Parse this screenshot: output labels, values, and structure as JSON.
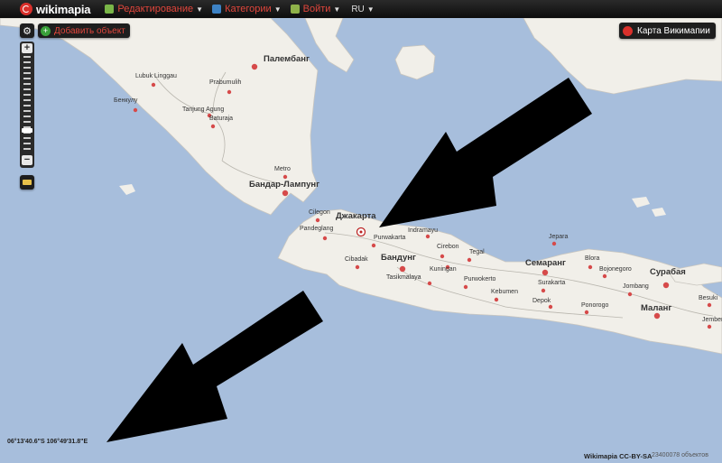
{
  "topbar": {
    "logo": "wikimapia",
    "menu": [
      {
        "label": "Редактирование",
        "icon": "edit-icon"
      },
      {
        "label": "Категории",
        "icon": "categories-icon"
      },
      {
        "label": "Войти",
        "icon": "login-icon"
      }
    ],
    "lang": "RU",
    "search_placeholder": ""
  },
  "controls": {
    "add_object": "Добавить объект",
    "wiki_map": "Карта Викимапии"
  },
  "colors": {
    "water": "#a7bedc",
    "land": "#f1efe9",
    "city": "#d64a4a",
    "accent": "#d9302b"
  },
  "cities": [
    {
      "name": "Палембанг",
      "major": true
    },
    {
      "name": "Lubuk Linggau",
      "major": false
    },
    {
      "name": "Prabumulih",
      "major": false
    },
    {
      "name": "Бенкулу",
      "major": false
    },
    {
      "name": "Tanjung Agung",
      "major": false
    },
    {
      "name": "Baturaja",
      "major": false
    },
    {
      "name": "Metro",
      "major": false
    },
    {
      "name": "Бандар-Лампунг",
      "major": true
    },
    {
      "name": "Cilegon",
      "major": false
    },
    {
      "name": "Джакарта",
      "major": true
    },
    {
      "name": "Pandeglang",
      "major": false
    },
    {
      "name": "Purwakarta",
      "major": false
    },
    {
      "name": "Indramayu",
      "major": false
    },
    {
      "name": "Cirebon",
      "major": false
    },
    {
      "name": "Cibadak",
      "major": false
    },
    {
      "name": "Бандунг",
      "major": true
    },
    {
      "name": "Kuningan",
      "major": false
    },
    {
      "name": "Tegal",
      "major": false
    },
    {
      "name": "Семаранг",
      "major": true
    },
    {
      "name": "Jepara",
      "major": false
    },
    {
      "name": "Blora",
      "major": false
    },
    {
      "name": "Bojonegoro",
      "major": false
    },
    {
      "name": "Сурабая",
      "major": true
    },
    {
      "name": "Tasikmalaya",
      "major": false
    },
    {
      "name": "Purwokerto",
      "major": false
    },
    {
      "name": "Kebumen",
      "major": false
    },
    {
      "name": "Surakarta",
      "major": false
    },
    {
      "name": "Depok",
      "major": false
    },
    {
      "name": "Ponorogo",
      "major": false
    },
    {
      "name": "Jombang",
      "major": false
    },
    {
      "name": "Маланг",
      "major": true
    },
    {
      "name": "Besuki",
      "major": false
    },
    {
      "name": "Jember",
      "major": false
    }
  ],
  "status": {
    "coords": "06°13'40.6\"S 106°49'31.8\"E",
    "credit": "Wikimapia CC-BY-SA",
    "count": "23400078 объектов"
  }
}
